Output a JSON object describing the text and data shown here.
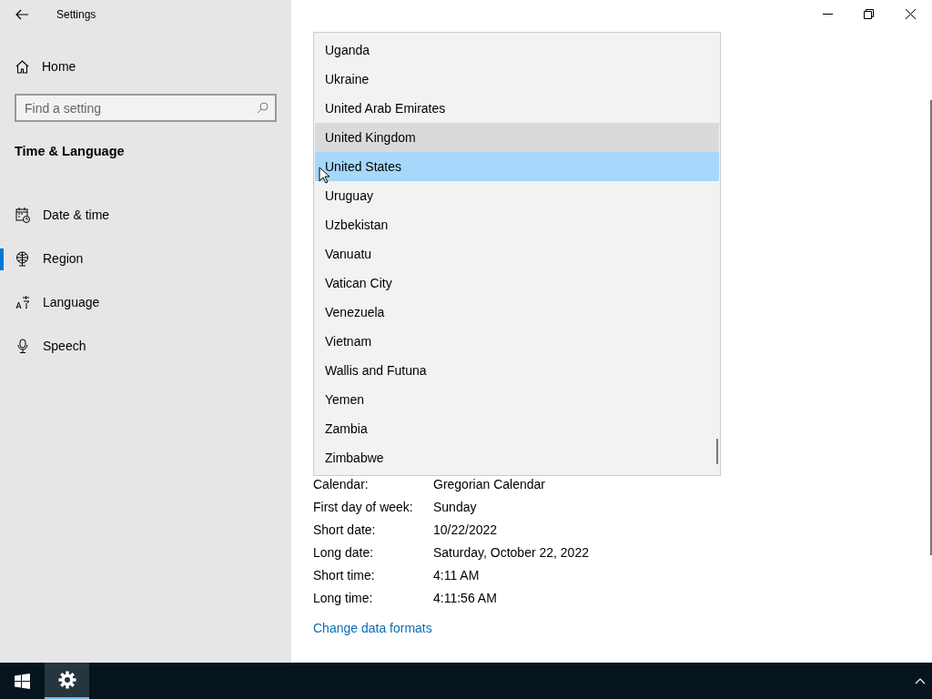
{
  "window": {
    "title": "Settings"
  },
  "sidebar": {
    "home": "Home",
    "search": {
      "placeholder": "Find a setting"
    },
    "section": "Time & Language",
    "items": [
      {
        "label": "Date & time",
        "kind": "calendar",
        "selected": false
      },
      {
        "label": "Region",
        "kind": "globe",
        "selected": true
      },
      {
        "label": "Language",
        "kind": "language",
        "selected": false
      },
      {
        "label": "Speech",
        "kind": "microphone",
        "selected": false
      }
    ]
  },
  "dropdown": {
    "options": [
      {
        "label": "Uganda",
        "selected": false,
        "hovered": false
      },
      {
        "label": "Ukraine",
        "selected": false,
        "hovered": false
      },
      {
        "label": "United Arab Emirates",
        "selected": false,
        "hovered": false
      },
      {
        "label": "United Kingdom",
        "selected": false,
        "hovered": true
      },
      {
        "label": "United States",
        "selected": true,
        "hovered": false
      },
      {
        "label": "Uruguay",
        "selected": false,
        "hovered": false
      },
      {
        "label": "Uzbekistan",
        "selected": false,
        "hovered": false
      },
      {
        "label": "Vanuatu",
        "selected": false,
        "hovered": false
      },
      {
        "label": "Vatican City",
        "selected": false,
        "hovered": false
      },
      {
        "label": "Venezuela",
        "selected": false,
        "hovered": false
      },
      {
        "label": "Vietnam",
        "selected": false,
        "hovered": false
      },
      {
        "label": "Wallis and Futuna",
        "selected": false,
        "hovered": false
      },
      {
        "label": "Yemen",
        "selected": false,
        "hovered": false
      },
      {
        "label": "Zambia",
        "selected": false,
        "hovered": false
      },
      {
        "label": "Zimbabwe",
        "selected": false,
        "hovered": false
      }
    ]
  },
  "formats": [
    {
      "label": "Calendar:",
      "value": "Gregorian Calendar"
    },
    {
      "label": "First day of week:",
      "value": "Sunday"
    },
    {
      "label": "Short date:",
      "value": "10/22/2022"
    },
    {
      "label": "Long date:",
      "value": "Saturday, October 22, 2022"
    },
    {
      "label": "Short time:",
      "value": "4:11 AM"
    },
    {
      "label": "Long time:",
      "value": "4:11:56 AM"
    }
  ],
  "change_link": "Change data formats",
  "taskbar": {
    "settings_active": true
  }
}
